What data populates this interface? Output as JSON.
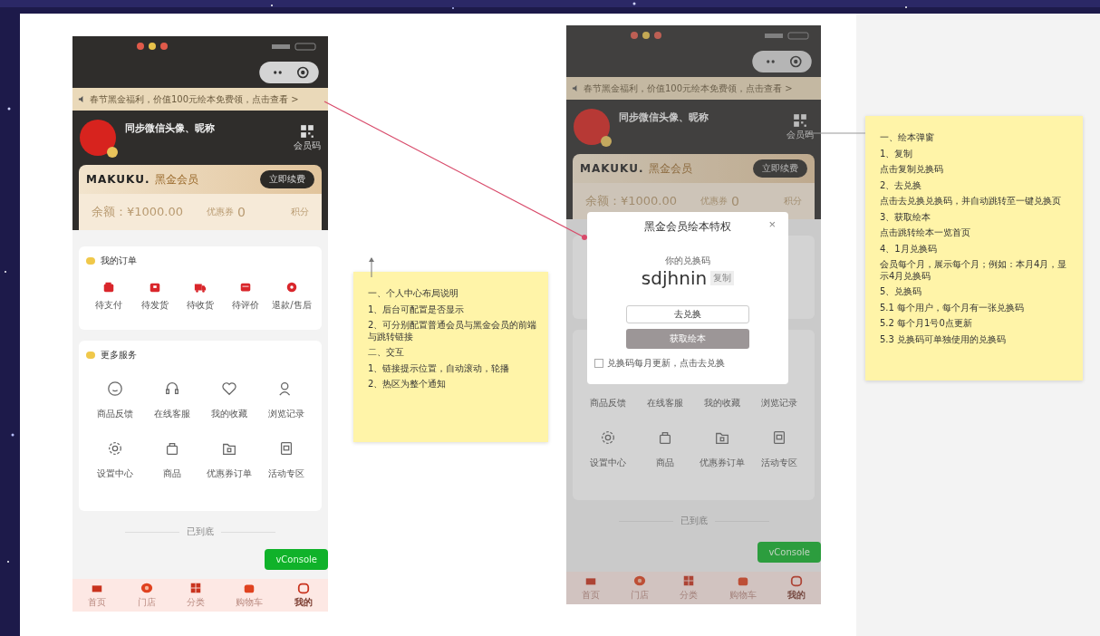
{
  "phones": [
    {
      "banner": "春节黑金福利，价值100元绘本免费领，点击查看 >",
      "profile": {
        "name": "同步微信头像、昵称",
        "qr_label": "会员码"
      },
      "membership": {
        "brand": "MAKUKU.",
        "tier": "黑金会员",
        "action": "立即续费",
        "balance": "余额：¥1000.00",
        "coupons_label": "优惠券",
        "coupons": "0",
        "points": "积分"
      },
      "orders": {
        "title": "我的订单",
        "items": [
          {
            "label": "待支付",
            "kind": "wallet"
          },
          {
            "label": "待发货",
            "kind": "box"
          },
          {
            "label": "待收货",
            "kind": "truck"
          },
          {
            "label": "待评价",
            "kind": "message"
          },
          {
            "label": "退款/售后",
            "kind": "refund"
          }
        ]
      },
      "services": {
        "title": "更多服务",
        "items": [
          {
            "label": "商品反馈",
            "kind": "smile"
          },
          {
            "label": "在线客服",
            "kind": "headset"
          },
          {
            "label": "我的收藏",
            "kind": "heart"
          },
          {
            "label": "浏览记录",
            "kind": "person"
          },
          {
            "label": "设置中心",
            "kind": "gear"
          },
          {
            "label": "商品",
            "kind": "bag"
          },
          {
            "label": "优惠券订单",
            "kind": "folder"
          },
          {
            "label": "活动专区",
            "kind": "page"
          }
        ]
      },
      "footer": "已到底",
      "console_button": "vConsole",
      "tabs": [
        {
          "label": "首页",
          "kind": "home",
          "selected": false
        },
        {
          "label": "门店",
          "kind": "store",
          "selected": false
        },
        {
          "label": "分类",
          "kind": "grid",
          "selected": false
        },
        {
          "label": "购物车",
          "kind": "cart",
          "selected": false
        },
        {
          "label": "我的",
          "kind": "me",
          "selected": true
        }
      ]
    },
    {
      "banner": "春节黑金福利，价值100元绘本免费领，点击查看 >",
      "profile": {
        "name": "同步微信头像、昵称",
        "qr_label": "会员码"
      },
      "membership": {
        "brand": "MAKUKU.",
        "tier": "黑金会员",
        "action": "立即续费",
        "balance": "余额：¥1000.00",
        "coupons_label": "优惠券",
        "coupons": "0",
        "points": "积分"
      },
      "services": {
        "items": [
          {
            "label": "商品反馈"
          },
          {
            "label": "在线客服"
          },
          {
            "label": "我的收藏"
          },
          {
            "label": "浏览记录"
          },
          {
            "label": "设置中心",
            "kind": "gear"
          },
          {
            "label": "商品",
            "kind": "bag"
          },
          {
            "label": "优惠券订单",
            "kind": "folder"
          },
          {
            "label": "活动专区",
            "kind": "page"
          }
        ]
      },
      "footer": "已到底",
      "console_button": "vConsole",
      "tabs": [
        {
          "label": "首页",
          "kind": "home",
          "selected": false
        },
        {
          "label": "门店",
          "kind": "store",
          "selected": false
        },
        {
          "label": "分类",
          "kind": "grid",
          "selected": false
        },
        {
          "label": "购物车",
          "kind": "cart",
          "selected": false
        },
        {
          "label": "我的",
          "kind": "me",
          "selected": true
        }
      ],
      "modal": {
        "title": "黑金会员绘本特权",
        "close": "×",
        "code_label": "你的兑换码",
        "code": "sdjhnin",
        "copy": "复制",
        "primary": "去兑换",
        "secondary": "获取绘本",
        "agreement": "兑换码每月更新，点击去兑换",
        "agreed": false
      }
    }
  ],
  "notes": [
    {
      "lines": [
        "一、个人中心布局说明",
        "1、后台可配置是否显示",
        "2、可分别配置普通会员与黑金会员的前端与跳转链接",
        "二、交互",
        "1、链接提示位置，自动滚动，轮播",
        "2、热区为整个通知"
      ]
    },
    {
      "lines": [
        "一、绘本弹窗",
        "1、复制",
        "点击复制兑换码",
        "2、去兑换",
        "点击去兑换兑换码，并自动跳转至一键兑换页",
        "3、获取绘本",
        "点击跳转绘本一览首页",
        "4、1月兑换码",
        "会员每个月，展示每个月；例如：本月4月，显示4月兑换码",
        "5、兑换码",
        "5.1 每个用户，每个月有一张兑换码",
        "5.2 每个月1号0点更新",
        "5.3 兑换码可单独使用的兑换码"
      ]
    }
  ]
}
